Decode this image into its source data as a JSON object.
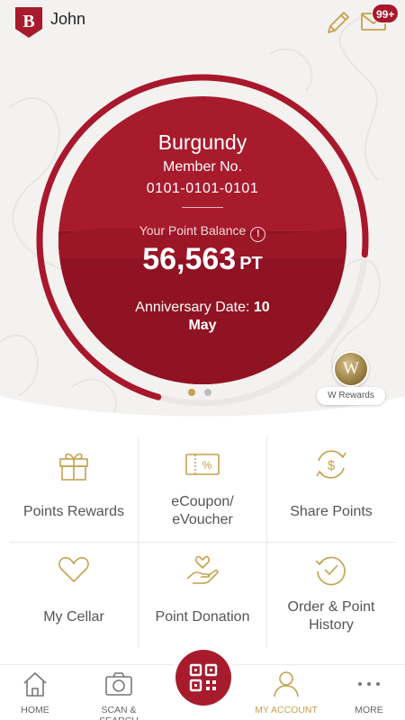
{
  "header": {
    "logo_letter": "B",
    "username": "John",
    "mail_badge": "99+"
  },
  "membership": {
    "tier": "Burgundy",
    "member_label": "Member No.",
    "member_number": "0101-0101-0101",
    "balance_label": "Your Point Balance",
    "info_glyph": "!",
    "points": "56,563",
    "points_unit": "PT",
    "anniversary_label": "Anniversary Date:",
    "anniversary_day": "10",
    "anniversary_month": "May",
    "progress_fraction": 0.72
  },
  "carousel": {
    "pages": 2,
    "active_index": 0
  },
  "w_rewards": {
    "letter": "W",
    "label": "W Rewards"
  },
  "grid": {
    "items": [
      {
        "label": "Points Rewards",
        "icon": "gift-icon"
      },
      {
        "label": "eCoupon/",
        "label2": "eVoucher",
        "icon": "coupon-icon"
      },
      {
        "label": "Share Points",
        "icon": "share-points-icon"
      },
      {
        "label": "My Cellar",
        "icon": "heart-icon"
      },
      {
        "label": "Point Donation",
        "icon": "donation-icon"
      },
      {
        "label": "Order & Point",
        "label2": "History",
        "icon": "history-icon"
      }
    ]
  },
  "nav": {
    "home": "HOME",
    "scan_search": "SCAN & SEARCH",
    "my_account": "MY ACCOUNT",
    "more": "MORE",
    "active": "my_account"
  },
  "colors": {
    "burgundy": "#a71b2c",
    "burgundy_dark": "#8f1322",
    "gold": "#c4a24e",
    "ring": "#a8172b"
  }
}
